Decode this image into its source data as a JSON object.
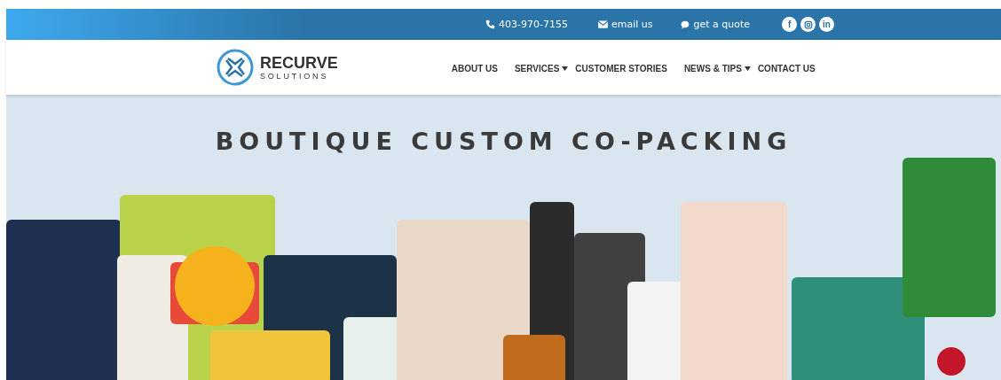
{
  "top_bar": {
    "contacts": [
      {
        "kind": "phone",
        "label": "403-970-7155"
      },
      {
        "kind": "email",
        "label": "email us"
      },
      {
        "kind": "chat",
        "label": "get a quote"
      }
    ],
    "social": [
      {
        "kind": "letter",
        "label": "f"
      },
      {
        "kind": "camera"
      },
      {
        "kind": "letter",
        "label": "in"
      }
    ]
  },
  "logo": {
    "name": "RECURVE",
    "tagline": "SOLUTIONS"
  },
  "nav": [
    {
      "label": "ABOUT US",
      "has_menu": false
    },
    {
      "label": "SERVICES",
      "has_menu": true
    },
    {
      "label": "CUSTOMER STORIES",
      "has_menu": false
    },
    {
      "label": "NEWS & TIPS",
      "has_menu": true
    },
    {
      "label": "CONTACT US",
      "has_menu": false
    }
  ],
  "hero": {
    "title": "BOUTIQUE CUSTOM CO-PACKING"
  }
}
